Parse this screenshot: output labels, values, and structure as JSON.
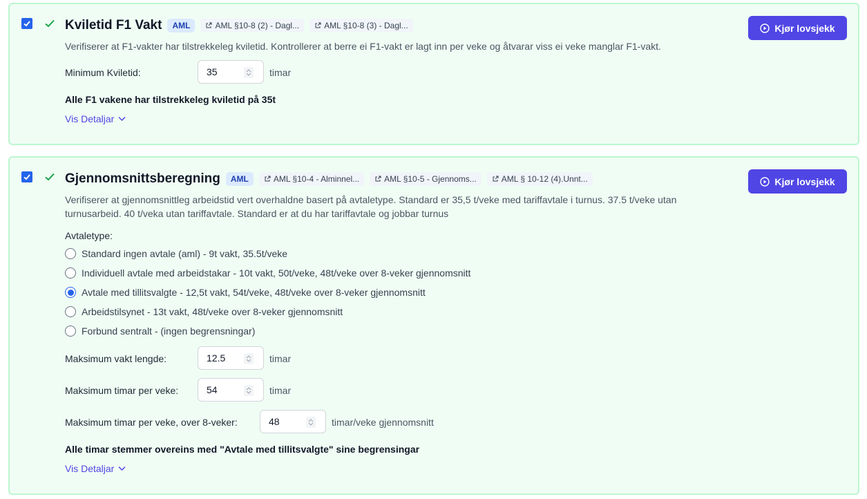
{
  "card1": {
    "title": "Kviletid F1 Vakt",
    "badge": "AML",
    "refs": [
      "AML §10-8 (2) - Dagl...",
      "AML §10-8 (3) - Dagl..."
    ],
    "run_button": "Kjør lovsjekk",
    "description": "Verifiserer at F1-vakter har tilstrekkeleg kviletid. Kontrollerer at berre ei F1-vakt er lagt inn per veke og åtvarar viss ei veke manglar F1-vakt.",
    "field_label": "Minimum Kviletid:",
    "field_value": "35",
    "field_unit": "timar",
    "result": "Alle F1 vakene har tilstrekkeleg kviletid på 35t",
    "details_link": "Vis Detaljar",
    "checked": true
  },
  "card2": {
    "title": "Gjennomsnittsberegning",
    "badge": "AML",
    "refs": [
      "AML §10-4 - Alminnel...",
      "AML §10-5 - Gjennoms...",
      "AML § 10-12 (4).Unnt..."
    ],
    "run_button": "Kjør lovsjekk",
    "description_line1": "Verifiserer at gjennomsnittleg arbeidstid vert overhaldne basert på avtaletype. Standard er 35,5 t/veke med tariffavtale i turnus. 37.5 t/veke utan",
    "description_line2": "turnusarbeid. 40 t/veka utan tariffavtale. Standard er at du har tariffavtale og jobbar turnus",
    "agreement_label": "Avtaletype:",
    "options": [
      "Standard ingen avtale (aml) - 9t vakt, 35.5t/veke",
      "Individuell avtale med arbeidstakar - 10t vakt, 50t/veke, 48t/veke over 8-veker gjennomsnitt",
      "Avtale med tillitsvalgte - 12,5t vakt, 54t/veke, 48t/veke over 8-veker gjennomsnitt",
      "Arbeidstilsynet - 13t vakt, 48t/veke over 8-veker gjennomsnitt",
      "Forbund sentralt - (ingen begrensningar)"
    ],
    "selected_option": "Avtale med tillitsvalgte - 12,5t vakt, 54t/veke, 48t/veke over 8-veker gjennomsnitt",
    "fields": [
      {
        "label": "Maksimum vakt lengde:",
        "value": "12.5",
        "unit": "timar"
      },
      {
        "label": "Maksimum timar per veke:",
        "value": "54",
        "unit": "timar"
      },
      {
        "label": "Maksimum timar per veke, over 8-veker:",
        "value": "48",
        "unit": "timar/veke gjennomsnitt"
      }
    ],
    "result": "Alle timar stemmer overeins med \"Avtale med tillitsvalgte\" sine begrensingar",
    "details_link": "Vis Detaljar",
    "checked": true
  },
  "colors": {
    "card_bg": "#f0fdf4",
    "card_border": "#bbf7d0",
    "primary_button": "#4f46e5",
    "checkbox": "#2563eb",
    "status_check": "#16a34a",
    "link": "#4f46e5"
  },
  "icons": [
    "checkbox-checked-icon",
    "check-icon",
    "external-link-icon",
    "play-circle-icon",
    "chevron-down-icon",
    "spinner-arrows-icon"
  ]
}
